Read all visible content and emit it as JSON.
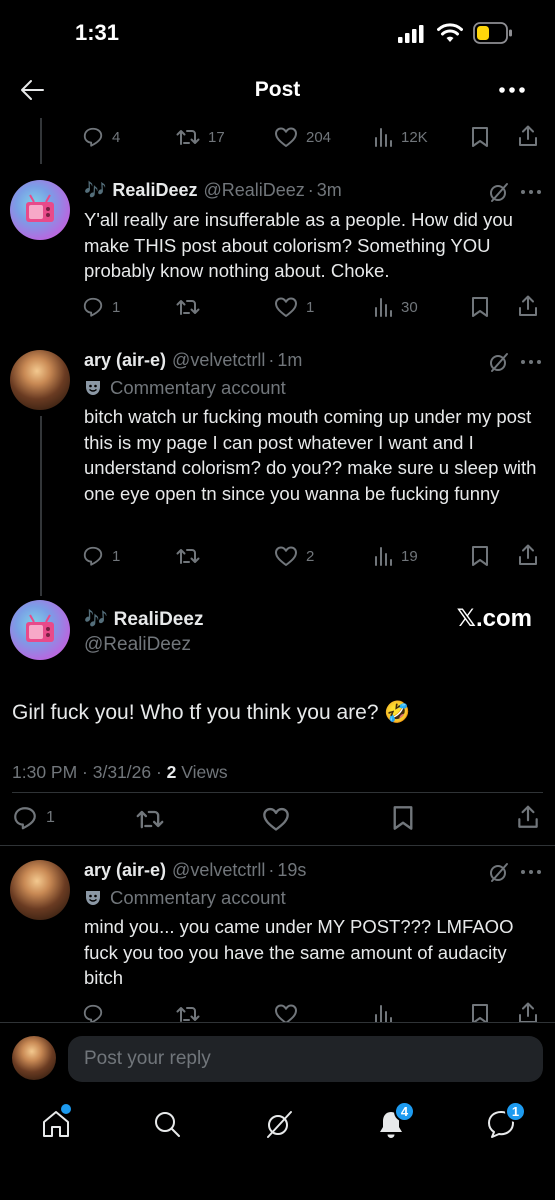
{
  "status_bar": {
    "time": "1:31"
  },
  "header": {
    "title": "Post"
  },
  "top_actions": {
    "replies": "4",
    "reposts": "17",
    "likes": "204",
    "views": "12K"
  },
  "reply1": {
    "emoji": "🎶",
    "name": "RealiDeez",
    "handle": "@RealiDeez",
    "time": "3m",
    "text": "Y'all really are insufferable as a people. How did you make THIS post about colorism? Something YOU probably know nothing about. Choke.",
    "actions": {
      "replies": "1",
      "reposts": "",
      "likes": "1",
      "views": "30"
    }
  },
  "reply2": {
    "name": "ary (air-e)",
    "handle": "@velvetctrll",
    "time": "1m",
    "label": "Commentary account",
    "text": "bitch watch ur fucking mouth coming up under my post this is my page I can post whatever I want and I understand colorism? do you?? make sure u sleep with one eye open tn since you wanna be fucking funny",
    "actions": {
      "replies": "1",
      "reposts": "",
      "likes": "2",
      "views": "19"
    }
  },
  "main": {
    "emoji": "🎶",
    "name": "RealiDeez",
    "handle": "@RealiDeez",
    "watermark": "𝕏.com",
    "text": "Girl fuck you! Who tf you think you are? 🤣",
    "time": "1:30 PM · 3/31/26 · ",
    "views_count": "2",
    "views_label": " Views",
    "replies": "1"
  },
  "reply3": {
    "name": "ary (air-e)",
    "handle": "@velvetctrll",
    "time": "19s",
    "label": "Commentary account",
    "text": "mind you... you came under MY POST??? LMFAOO fuck you too you have the same amount of audacity bitch"
  },
  "compose": {
    "placeholder": "Post your reply"
  },
  "tabbar": {
    "notifications_badge": "4",
    "messages_badge": "1"
  },
  "colors": {
    "accent": "#1d9bf0",
    "background": "#000000",
    "text": "#e7e9ea",
    "muted": "#71767b"
  }
}
